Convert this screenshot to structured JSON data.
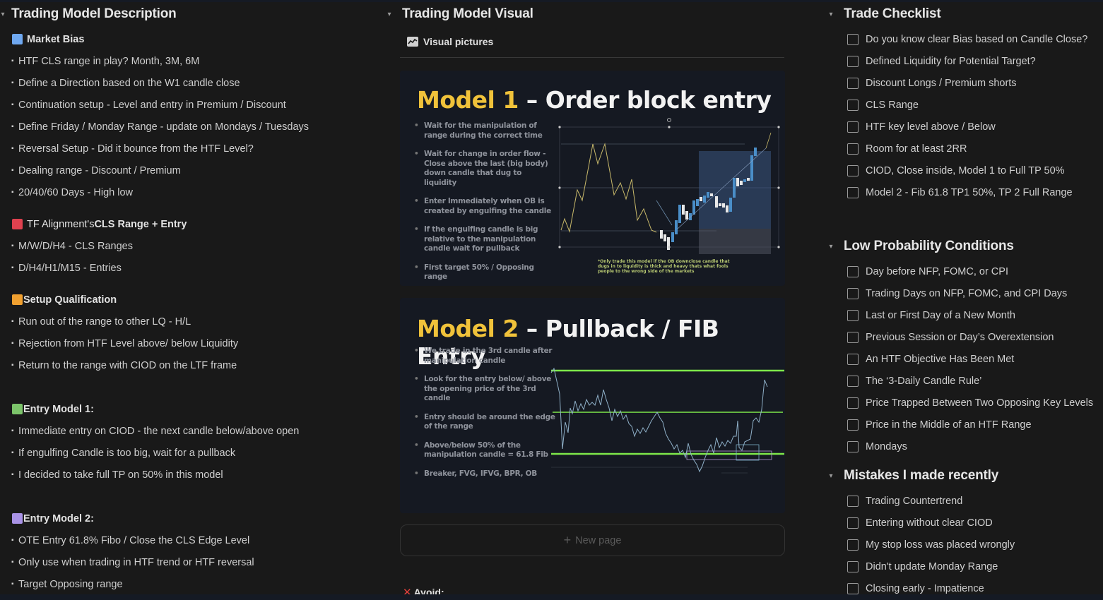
{
  "left": {
    "title": "Trading Model Description",
    "blocks": [
      {
        "color": "#6fa8f0",
        "heading": "Market Bias",
        "heading_prefix": "",
        "items": [
          "HTF CLS range in play? Month, 3M, 6M",
          "Define a Direction based on the W1 candle close",
          "Continuation setup - Level and entry in Premium / Discount",
          "Define Friday / Monday Range - update on Mondays / Tuesdays",
          "Reversal Setup - Did it bounce from the HTF Level?",
          "Dealing range - Discount / Premium",
          "20/40/60 Days - High low"
        ]
      },
      {
        "color": "#e0414f",
        "heading_prefix": "TF Alignment's ",
        "heading": "CLS Range + Entry",
        "items": [
          "M/W/D/H4 - CLS Ranges",
          "D/H4/H1/M15 - Entries"
        ]
      },
      {
        "color": "#f0a030",
        "heading": "Setup Qualification",
        "heading_prefix": "",
        "items": [
          "Run out of the range to other LQ - H/L",
          "Rejection from HTF Level above/ below Liquidity",
          "Return to the range with CIOD on the LTF frame"
        ]
      },
      {
        "color": "#7cc46a",
        "heading": "Entry Model 1:",
        "heading_prefix": "",
        "items": [
          "Immediate entry on CIOD - the next candle below/above open",
          "If engulfing Candle is too big, wait for a pullback",
          "I decided to take full TP on 50% in this model"
        ]
      },
      {
        "color": "#a993e6",
        "heading": "Entry Model 2:",
        "heading_prefix": "",
        "items": [
          "OTE Entry 61.8% Fibo / Close the CLS Edge Level",
          "Only use when trading in HTF trend or HTF reversal",
          "Target Opposing range"
        ]
      }
    ]
  },
  "middle": {
    "title": "Trading Model Visual",
    "link_label": "Visual pictures",
    "model1": {
      "title_accent": "Model 1",
      "title_rest": " – Order block entry",
      "bullets": [
        "Wait for the manipulation of range during the correct time",
        "Wait for change in order flow - Close above the last (big body) down candle that dug to liquidity",
        "Enter Immediately when OB is created by engulfing the candle",
        "If the engulfing candle is big relative to the manipulation candle wait for pullback",
        "First target 50% / Opposing range"
      ],
      "note": "*Only trade this model if the OB downclose candle that dugs in to liquidity is thick and heavy thats what fools people to the wrong side of the markets"
    },
    "model2": {
      "title_accent": "Model 2",
      "title_rest": " – Pullback / FIB Entry",
      "bullets": [
        "We trade in the 3rd candle after manipulation candle",
        "Look for the entry below/ above the opening price of the 3rd candle",
        "Entry should be around the edge of the range",
        "Above/below 50% of the manipulation candle = 61.8 Fib",
        "Breaker, FVG, IFVG, BPR, OB"
      ]
    },
    "new_page_label": "New page",
    "avoid_label": "Avoid:"
  },
  "right": {
    "sections": [
      {
        "title": "Trade Checklist",
        "items": [
          "Do you know clear Bias based on Candle Close?",
          "Defined Liquidity for Potential Target?",
          "Discount Longs / Premium shorts",
          "CLS Range",
          "HTF key level above / Below",
          "Room for at least 2RR",
          "CIOD, Close inside, Model 1 to Full TP 50%",
          "Model 2 - Fib 61.8 TP1 50%, TP 2 Full Range"
        ]
      },
      {
        "title": "Low Probability Conditions",
        "items": [
          "Day before NFP, FOMC, or CPI",
          "Trading Days on NFP, FOMC, and CPI Days",
          "Last or First Day of a New Month",
          "Previous Session or Day’s Overextension",
          "An HTF Objective Has Been Met",
          "The ‘3-Daily Candle Rule’",
          "Price Trapped Between Two Opposing Key Levels",
          "Price in the Middle of an HTF Range",
          "Mondays"
        ]
      },
      {
        "title": "Mistakes I made recently",
        "items": [
          "Trading Countertrend",
          "Entering without clear CIOD",
          "My stop loss was placed wrongly",
          "Didn't update Monday Range",
          "Closing early - Impatience"
        ]
      }
    ]
  },
  "colors": {
    "background": "#191919",
    "accent_yellow": "#f0c23a",
    "range_green": "#7ee84a",
    "candle_blue": "#4a8ec8"
  }
}
